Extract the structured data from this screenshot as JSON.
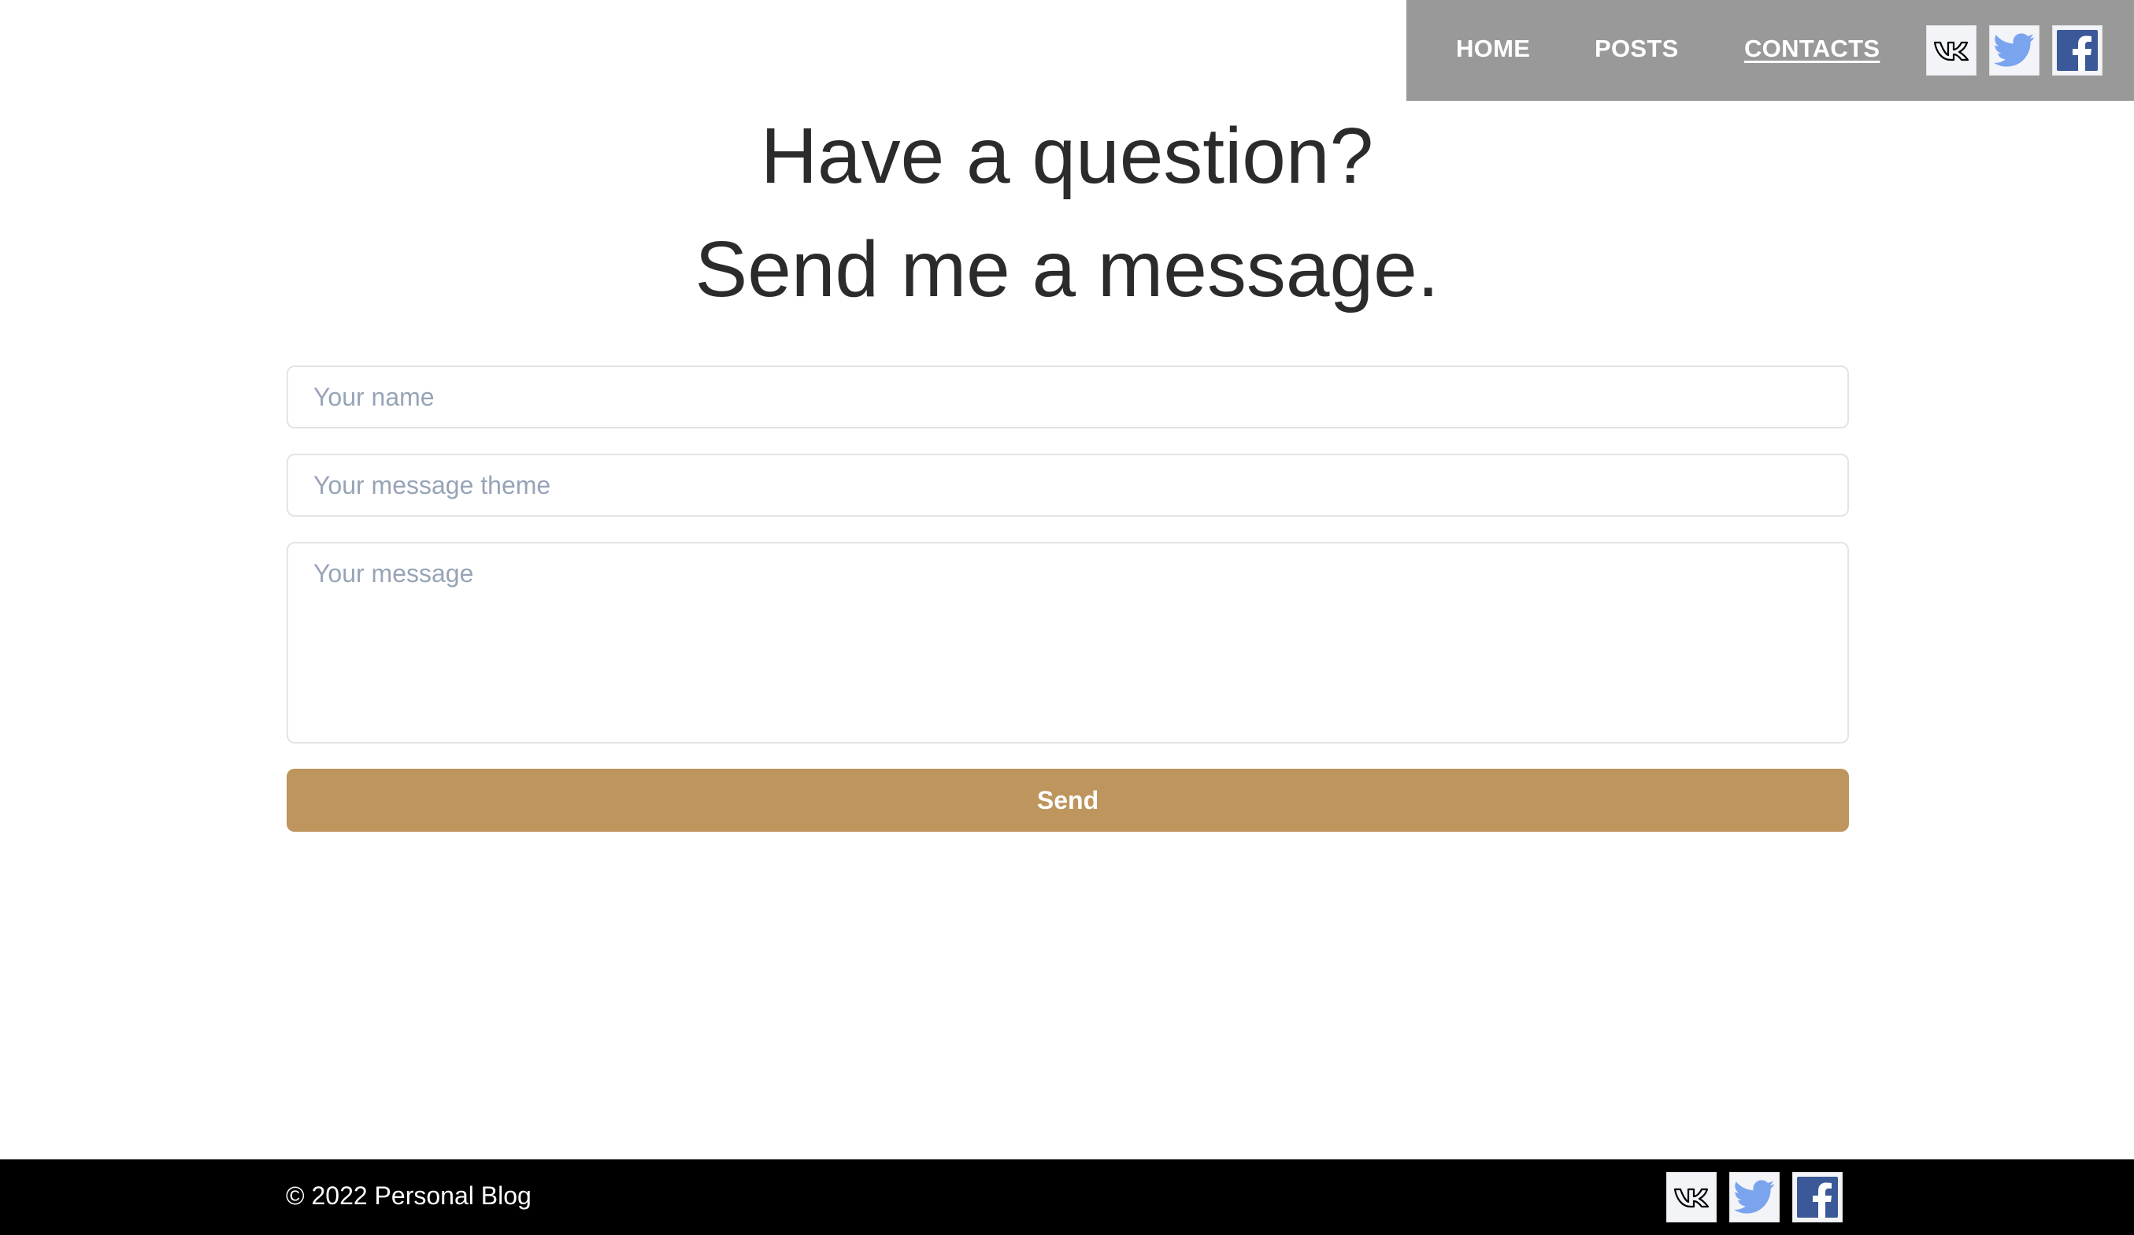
{
  "nav": {
    "links": [
      {
        "label": "HOME"
      },
      {
        "label": "POSTS"
      },
      {
        "label": "CONTACTS",
        "active": true
      }
    ],
    "social": [
      "vk-icon",
      "twitter-icon",
      "facebook-icon"
    ]
  },
  "main": {
    "heading_line1": "Have a question?",
    "heading_line2": "Send me a message.",
    "form": {
      "name_placeholder": "Your name",
      "name_value": "",
      "theme_placeholder": "Your message theme",
      "theme_value": "",
      "message_placeholder": "Your message",
      "message_value": "",
      "send_label": "Send"
    }
  },
  "footer": {
    "copyright": "© 2022 Personal Blog",
    "social": [
      "vk-icon",
      "twitter-icon",
      "facebook-icon"
    ]
  },
  "colors": {
    "nav_background": "#999999",
    "button_background": "#bd955d",
    "footer_background": "#000000",
    "twitter_blue": "#7ba4ee",
    "facebook_blue": "#3b5998"
  }
}
